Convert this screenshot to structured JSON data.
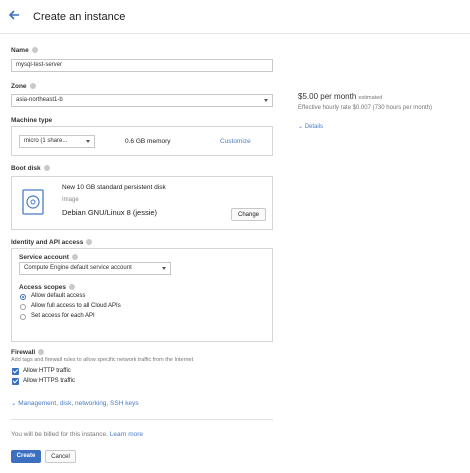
{
  "header": {
    "title": "Create an instance"
  },
  "name": {
    "label": "Name",
    "value": "mysql-test-server"
  },
  "zone": {
    "label": "Zone",
    "value": "asia-northeast1-b"
  },
  "machine_type": {
    "label": "Machine type",
    "select_value": "micro (1 share...",
    "memory": "0.6 GB memory",
    "customize": "Customize"
  },
  "pricing": {
    "price": "$5.00 per month",
    "price_suffix": "estimated",
    "hourly": "Effective hourly rate $0.007 (730 hours per month)",
    "details": "Details"
  },
  "boot_disk": {
    "label": "Boot disk",
    "disk_desc": "New 10 GB standard persistent disk",
    "image_label": "Image",
    "image_name": "Debian GNU/Linux 8 (jessie)",
    "change": "Change"
  },
  "identity": {
    "label": "Identity and API access",
    "service_account_label": "Service account",
    "service_account_value": "Compute Engine default service account",
    "access_scopes_label": "Access scopes",
    "scopes": [
      "Allow default access",
      "Allow full access to all Cloud APIs",
      "Set access for each API"
    ]
  },
  "firewall": {
    "label": "Firewall",
    "desc": "Add tags and firewall rules to allow specific network traffic from the Internet",
    "http": "Allow HTTP traffic",
    "https": "Allow HTTPS traffic"
  },
  "management_link": "Management, disk, networking, SSH keys",
  "billing_note": "You will be billed for this instance.",
  "learn_more": "Learn more",
  "buttons": {
    "create": "Create",
    "cancel": "Cancel"
  },
  "colors": {
    "accent": "#3b6fc0",
    "link": "#4a7bc4"
  }
}
